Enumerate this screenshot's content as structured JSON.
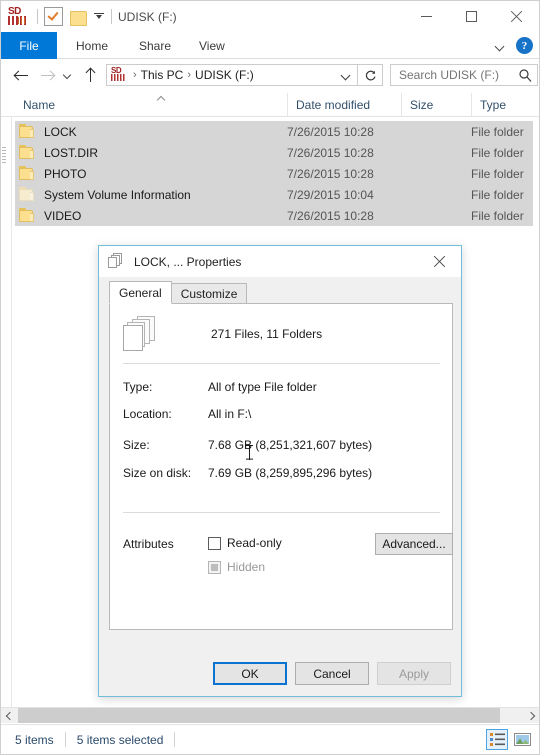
{
  "window": {
    "title": "UDISK (F:)",
    "sd_label": "SD",
    "quick_access": {
      "properties_tooltip": "Properties",
      "new_folder_tooltip": "New folder",
      "customize_tooltip": "Customize Quick Access Toolbar"
    },
    "controls": {
      "minimize": "Minimize",
      "maximize": "Maximize",
      "close": "Close"
    }
  },
  "ribbon": {
    "tabs": [
      {
        "label": "File"
      },
      {
        "label": "Home"
      },
      {
        "label": "Share"
      },
      {
        "label": "View"
      }
    ],
    "expand_tooltip": "Expand the Ribbon",
    "help_label": "?"
  },
  "address": {
    "back_tooltip": "Back",
    "forward_tooltip": "Forward",
    "recent_tooltip": "Recent locations",
    "up_tooltip": "Up to This PC",
    "breadcrumb": [
      "This PC",
      "UDISK (F:)"
    ],
    "separator": "›",
    "refresh_tooltip": "Refresh"
  },
  "search": {
    "placeholder": "Search UDISK (F:)",
    "value": ""
  },
  "columns": [
    {
      "label": "Name",
      "sorted": "asc"
    },
    {
      "label": "Date modified"
    },
    {
      "label": "Size"
    },
    {
      "label": "Type"
    }
  ],
  "files": [
    {
      "name": "LOCK",
      "date": "7/26/2015 10:28",
      "size": "",
      "type": "File folder",
      "selected": true,
      "hidden": false
    },
    {
      "name": "LOST.DIR",
      "date": "7/26/2015 10:28",
      "size": "",
      "type": "File folder",
      "selected": true,
      "hidden": false
    },
    {
      "name": "PHOTO",
      "date": "7/26/2015 10:28",
      "size": "",
      "type": "File folder",
      "selected": true,
      "hidden": false
    },
    {
      "name": "System Volume Information",
      "date": "7/29/2015 10:04",
      "size": "",
      "type": "File folder",
      "selected": true,
      "hidden": true
    },
    {
      "name": "VIDEO",
      "date": "7/26/2015 10:28",
      "size": "",
      "type": "File folder",
      "selected": true,
      "hidden": false
    }
  ],
  "status": {
    "item_count": "5 items",
    "selection": "5 items selected",
    "view_details_tooltip": "Details view",
    "view_large_tooltip": "Large icons view"
  },
  "dialog": {
    "title": "LOCK, ... Properties",
    "close_tooltip": "Close",
    "tabs": [
      {
        "label": "General",
        "active": true
      },
      {
        "label": "Customize",
        "active": false
      }
    ],
    "summary": "271 Files, 11 Folders",
    "fields": [
      {
        "label": "Type:",
        "value": "All of type File folder"
      },
      {
        "label": "Location:",
        "value": "All in F:\\"
      },
      {
        "label": "Size:",
        "value": "7.68 GB (8,251,321,607 bytes)"
      },
      {
        "label": "Size on disk:",
        "value": "7.69 GB (8,259,895,296 bytes)"
      }
    ],
    "attributes": {
      "label": "Attributes",
      "readonly": {
        "label": "Read-only",
        "accel": "R",
        "checked": false
      },
      "hidden": {
        "label": "Hidden",
        "accel": "H",
        "state": "indeterminate"
      },
      "advanced_button": {
        "label": "Advanced...",
        "accel": "d"
      }
    },
    "buttons": [
      {
        "label": "OK",
        "state": "default"
      },
      {
        "label": "Cancel",
        "state": "normal"
      },
      {
        "label": "Apply",
        "accel": "A",
        "state": "disabled"
      }
    ]
  },
  "colors": {
    "accent": "#0078d7",
    "dialog_border": "#6fbfd8",
    "selection": "#d6d6d6",
    "column_header_text": "#33506b",
    "status_text": "#2a4a6b",
    "folder_icon": "#fcdf8f"
  }
}
